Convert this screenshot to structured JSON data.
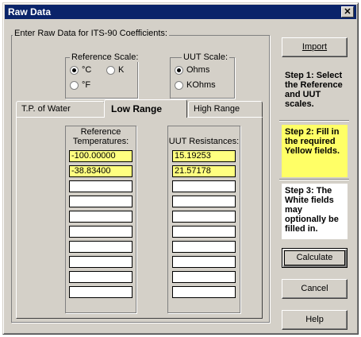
{
  "window": {
    "title": "Raw Data",
    "close_symbol": "✕"
  },
  "group_title": "Enter Raw Data for ITS-90 Coefficients:",
  "reference_scale": {
    "title": "Reference Scale:",
    "options": [
      "°C",
      "K",
      "°F"
    ],
    "selected": "°C"
  },
  "uut_scale": {
    "title": "UUT Scale:",
    "options": [
      "Ohms",
      "KOhms"
    ],
    "selected": "Ohms"
  },
  "tabs": [
    "T.P. of Water",
    "Low Range",
    "High Range"
  ],
  "active_tab": "Low Range",
  "columns": {
    "reference_label_line1": "Reference",
    "reference_label_line2": "Temperatures:",
    "uut_label": "UUT Resistances:"
  },
  "reference_values": [
    "-100.00000",
    "-38.83400",
    "",
    "",
    "",
    "",
    "",
    "",
    "",
    ""
  ],
  "uut_values": [
    "15.19253",
    "21.57178",
    "",
    "",
    "",
    "",
    "",
    "",
    "",
    ""
  ],
  "buttons": {
    "import": "Import",
    "calculate": "Calculate",
    "cancel": "Cancel",
    "help": "Help"
  },
  "steps": {
    "step1": "Step 1: Select the Reference and UUT scales.",
    "step2": "Step 2: Fill in the required Yellow fields.",
    "step3": "Step 3: The White fields may optionally be filled in."
  },
  "colors": {
    "required_field": "#ffff80",
    "title_bar": "#0a246a",
    "dialog": "#d4d0c8"
  }
}
